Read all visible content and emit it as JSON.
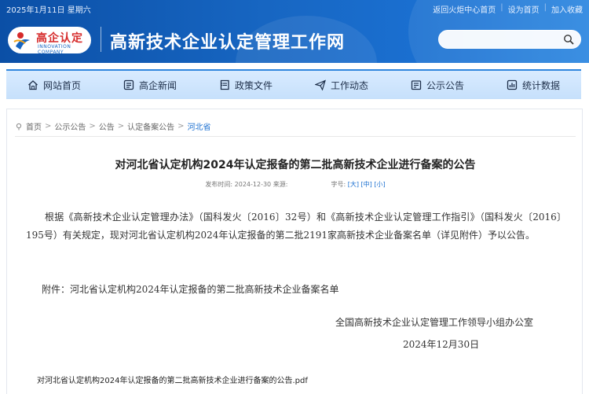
{
  "topbar": {
    "date": "2025年1月11日 星期六",
    "links": [
      "返回火炬中心首页",
      "设为首页",
      "加入收藏"
    ],
    "separator": "|"
  },
  "logo": {
    "cn": "高企认定",
    "en": "INNOVATION COMPANY"
  },
  "site": {
    "title": "高新技术企业认定管理工作网"
  },
  "search": {
    "placeholder": "",
    "value": ""
  },
  "nav": {
    "items": [
      {
        "label": "网站首页",
        "icon": "home-icon"
      },
      {
        "label": "高企新闻",
        "icon": "news-icon"
      },
      {
        "label": "政策文件",
        "icon": "file-icon"
      },
      {
        "label": "工作动态",
        "icon": "send-icon"
      },
      {
        "label": "公示公告",
        "icon": "notice-icon"
      },
      {
        "label": "统计数据",
        "icon": "stats-icon"
      }
    ]
  },
  "breadcrumb": {
    "items": [
      "首页",
      "公示公告",
      "公告",
      "认定备案公告"
    ],
    "current": "河北省",
    "separator": ">"
  },
  "article": {
    "title": "对河北省认定机构2024年认定报备的第二批高新技术企业进行备案的公告",
    "meta_published_label": "发布时间:",
    "meta_date": "2024-12-30",
    "meta_source_label": "来源:",
    "meta_size_label": "字号:",
    "meta_size_large": "[大]",
    "meta_size_medium": "[中]",
    "meta_size_small": "[小]",
    "paragraph1": "根据《高新技术企业认定管理办法》（国科发火〔2016〕32号）和《高新技术企业认定管理工作指引》（国科发火〔2016〕195号）有关规定，现对河北省认定机构2024年认定报备的第二批2191家高新技术企业备案名单（详见附件）予以公告。",
    "attachment_note": "附件：河北省认定机构2024年认定报备的第二批高新技术企业备案名单",
    "signature_org": "全国高新技术企业认定管理工作领导小组办公室",
    "signature_date": "2024年12月30日",
    "attachment_file": "对河北省认定机构2024年认定报备的第二批高新技术企业进行备案的公告.pdf"
  },
  "colors": {
    "banner": "#1766c2",
    "nav_bg": "#d9ebff",
    "accent": "#1a6fd0",
    "logo_red": "#d62a2a"
  }
}
